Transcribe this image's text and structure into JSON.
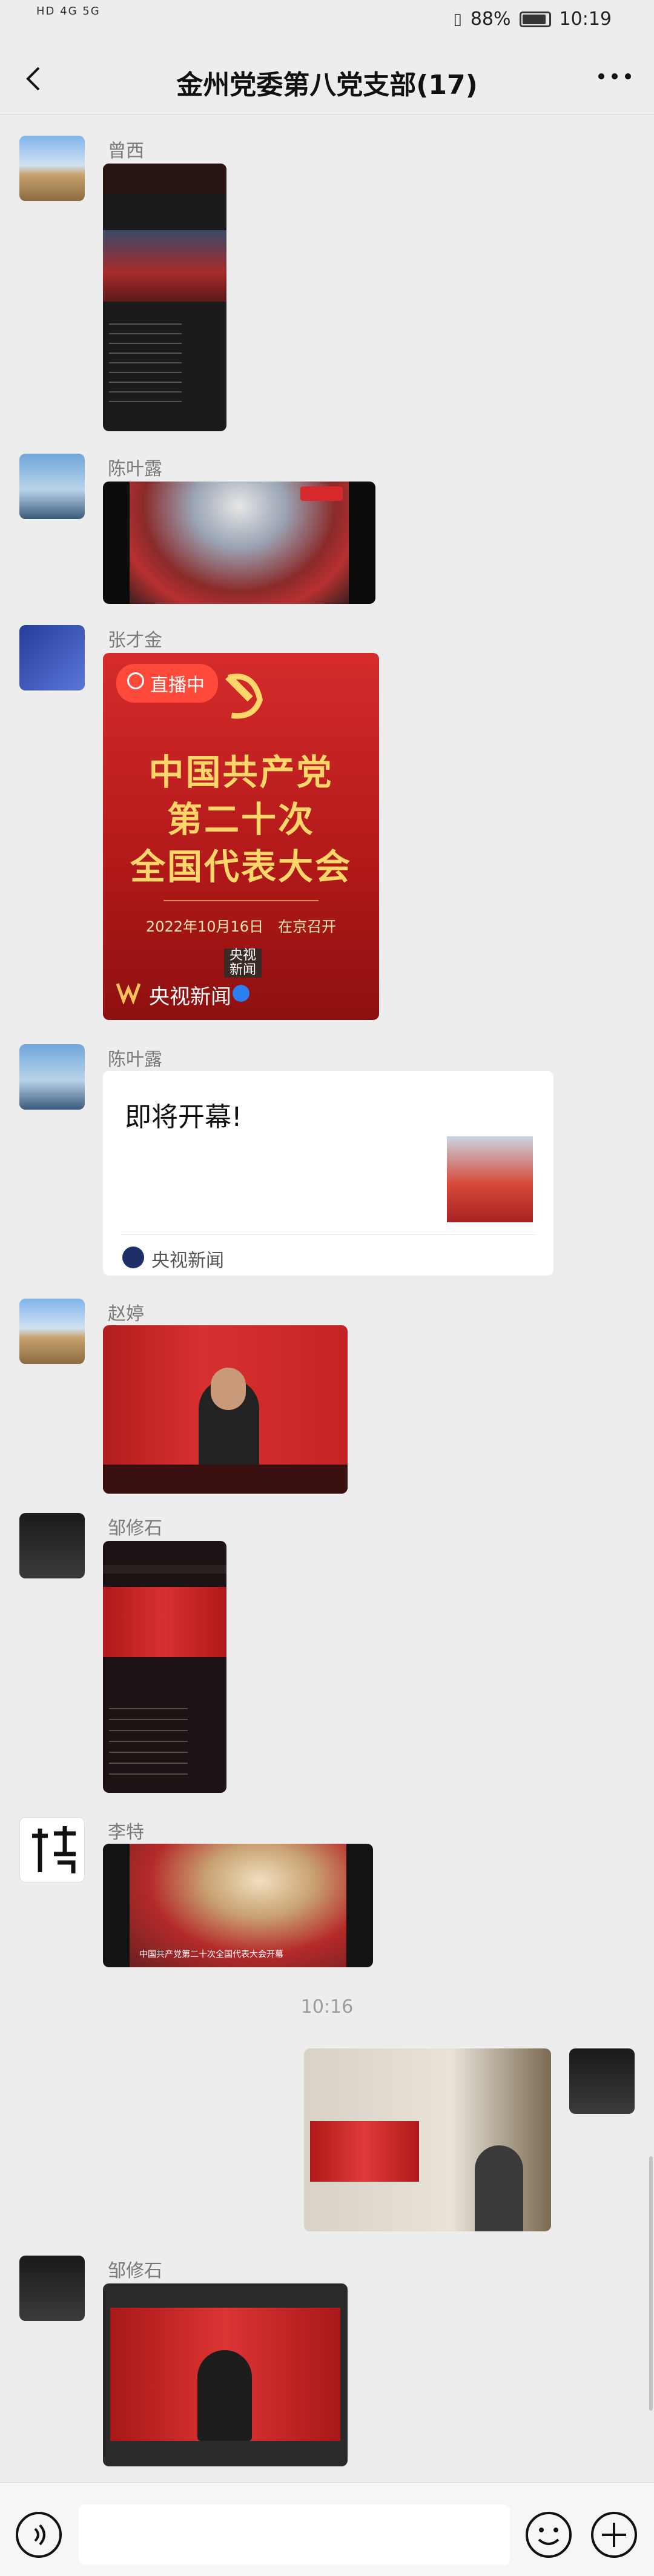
{
  "status_bar": {
    "network_left": "HD 4G  5G",
    "battery": "88%",
    "time": "10:19"
  },
  "header": {
    "title": "金州党委第八党支部(17)",
    "back_icon": "chevron-left-icon",
    "more_icon": "more-dots-icon"
  },
  "messages": [
    {
      "sender": "曾西",
      "type": "image",
      "content": "screenshot-video-feed"
    },
    {
      "sender": "陈叶露",
      "type": "image",
      "content": "great-hall-video"
    },
    {
      "sender": "张才金",
      "type": "poster",
      "live_label": "直播中",
      "title_lines": [
        "中国共产党",
        "第二十次",
        "全国代表大会"
      ],
      "date_line": "2022年10月16日　在京召开",
      "stamp": "央视\n新闻",
      "source": "央视新闻"
    },
    {
      "sender": "陈叶露",
      "type": "link-card",
      "card_title": "即将开幕!",
      "source": "央视新闻"
    },
    {
      "sender": "赵婷",
      "type": "image",
      "content": "speech-video-landscape"
    },
    {
      "sender": "邹修石",
      "type": "image",
      "content": "speech-video-portrait"
    },
    {
      "sender": "李特",
      "type": "image",
      "content": "hall-video-caption",
      "caption": "中国共产党第二十次全国代表大会开幕"
    },
    {
      "sender": "",
      "type": "time",
      "text": "10:16"
    },
    {
      "sender": "me",
      "type": "image",
      "content": "tv-photo-room"
    },
    {
      "sender": "邹修石",
      "type": "image",
      "content": "tv-photo-closeup"
    }
  ],
  "input_bar": {
    "voice_icon": "voice-icon",
    "emoji_icon": "emoji-icon",
    "plus_icon": "plus-icon",
    "placeholder": ""
  },
  "colors": {
    "background": "#ededed",
    "poster_red": "#c41f1f",
    "poster_gold": "#ffd66a",
    "live_red": "#ff4a3b"
  }
}
